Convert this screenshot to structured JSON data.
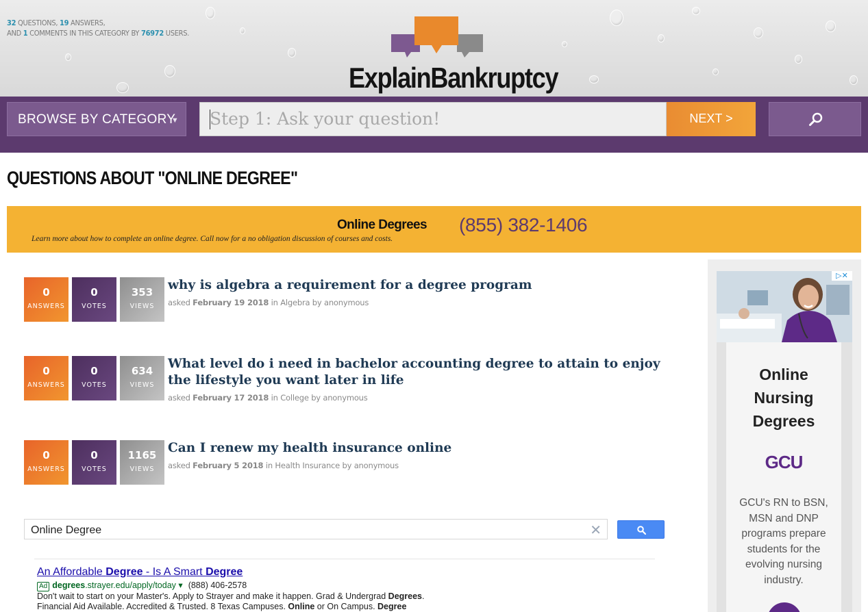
{
  "stats": {
    "questions": "32",
    "questions_label": "QUESTIONS,",
    "answers": "19",
    "answers_label": "ANSWERS,",
    "and_label": "AND",
    "comments": "1",
    "comments_label": "COMMENTS IN THIS CATEGORY BY",
    "users": "76972",
    "users_label": "USERS."
  },
  "site": {
    "name": "ExplainBankruptcy"
  },
  "nav": {
    "browse_label": "BROWSE BY CATEGORY",
    "ask_placeholder": "Step 1: Ask your question!",
    "next_label": "NEXT >"
  },
  "page": {
    "title": "QUESTIONS ABOUT \"ONLINE DEGREE\""
  },
  "banner": {
    "title": "Online Degrees",
    "description": "Learn more about how to complete an online degree. Call now for a no obligation discussion of courses and costs.",
    "phone": "(855) 382-1406"
  },
  "questions": [
    {
      "answers": "0",
      "answers_label": "ANSWERS",
      "votes": "0",
      "votes_label": "VOTES",
      "views": "353",
      "views_label": "VIEWS",
      "title": "why is algebra a requirement for a degree program",
      "asked": "asked",
      "date": "February 19 2018",
      "in": "in",
      "category": "Algebra",
      "by": "by",
      "author": "anonymous"
    },
    {
      "answers": "0",
      "answers_label": "ANSWERS",
      "votes": "0",
      "votes_label": "VOTES",
      "views": "634",
      "views_label": "VIEWS",
      "title": "What level do i need in bachelor accounting degree to attain to enjoy the lifestyle you want later in life",
      "asked": "asked",
      "date": "February 17 2018",
      "in": "in",
      "category": "College",
      "by": "by",
      "author": "anonymous"
    },
    {
      "answers": "0",
      "answers_label": "ANSWERS",
      "votes": "0",
      "votes_label": "VOTES",
      "views": "1165",
      "views_label": "VIEWS",
      "title": "Can I renew my health insurance online",
      "asked": "asked",
      "date": "February 5 2018",
      "in": "in",
      "category": "Health Insurance",
      "by": "by",
      "author": "anonymous"
    }
  ],
  "search": {
    "value": "Online Degree",
    "clear_icon": "close-icon",
    "button_icon": "search-icon"
  },
  "text_ad": {
    "title_parts": [
      "An Affordable ",
      "Degree",
      " - Is A Smart ",
      "Degree"
    ],
    "tag": "Ad",
    "url_bold": "degrees",
    "url_rest": ".strayer.edu/apply/today",
    "url_arrow": "▾",
    "phone": "(888) 406-2578",
    "line1_parts": [
      "Don't wait to start on your Master's. Apply to Strayer and make it happen. Grad & Undergrad ",
      "Degrees",
      "."
    ],
    "line2_parts": [
      "Financial Aid Available. Accredited & Trusted. 8 Texas Campuses. ",
      "Online",
      " or On Campus. ",
      "Degree"
    ]
  },
  "side_ad": {
    "title_lines": [
      "Online",
      "Nursing",
      "Degrees"
    ],
    "logo": "GCU",
    "description": "GCU's RN to BSN, MSN and DNP programs prepare students for the evolving nursing industry.",
    "adchoices_icon": "adchoices-icon"
  },
  "colors": {
    "purple": "#5c3a6e",
    "orange": "#f4b233",
    "teal": "#2a8fae",
    "navy": "#1f3a54"
  }
}
